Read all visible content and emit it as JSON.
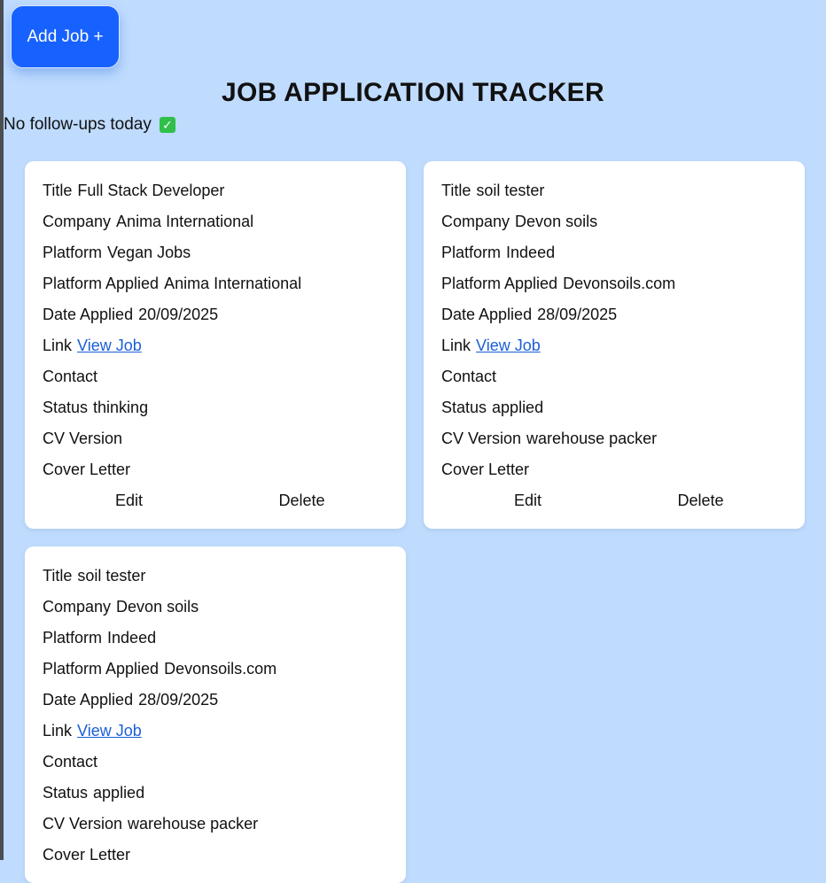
{
  "add_button_label": "Add Job +",
  "page_title": "JOB APPLICATION TRACKER",
  "followups_text": "No follow-ups today",
  "followups_icon": "check-mark-icon",
  "labels": {
    "title": "Title",
    "company": "Company",
    "platform": "Platform",
    "platform_applied": "Platform Applied",
    "date_applied": "Date Applied",
    "link": "Link",
    "contact": "Contact",
    "status": "Status",
    "cv_version": "CV Version",
    "cover_letter": "Cover Letter",
    "edit": "Edit",
    "delete": "Delete"
  },
  "jobs": [
    {
      "title": "Full Stack Developer",
      "company": "Anima International",
      "platform": "Vegan Jobs",
      "platform_applied": "Anima International",
      "date_applied": "20/09/2025",
      "link_text": "View Job",
      "contact": "",
      "status": "thinking",
      "cv_version": "",
      "cover_letter": ""
    },
    {
      "title": "soil tester",
      "company": "Devon soils",
      "platform": "Indeed",
      "platform_applied": "Devonsoils.com",
      "date_applied": "28/09/2025",
      "link_text": "View Job",
      "contact": "",
      "status": "applied",
      "cv_version": "warehouse packer",
      "cover_letter": ""
    },
    {
      "title": "soil tester",
      "company": "Devon soils",
      "platform": "Indeed",
      "platform_applied": "Devonsoils.com",
      "date_applied": "28/09/2025",
      "link_text": "View Job",
      "contact": "",
      "status": "applied",
      "cv_version": "warehouse packer",
      "cover_letter": ""
    }
  ],
  "colors": {
    "page_background": "#bfdbfe",
    "add_button": "#1762ff",
    "link": "#1a5fd8",
    "card_background": "#ffffff"
  }
}
